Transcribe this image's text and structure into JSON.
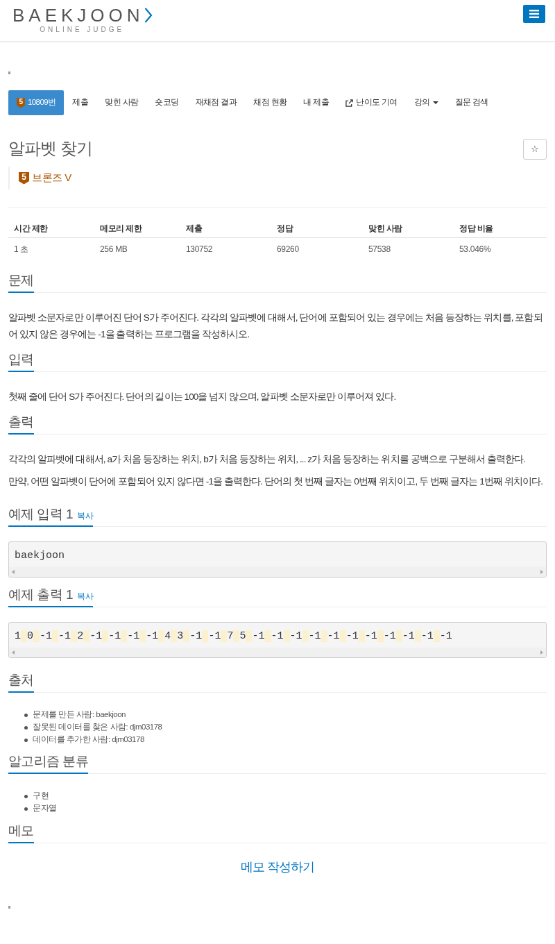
{
  "header": {
    "logo": {
      "wordmark": "BAEKJOON",
      "tagline": "ONLINE JUDGE"
    }
  },
  "tabs": [
    {
      "kind": "plain",
      "label": "10809번",
      "badge": "5",
      "selected": true
    },
    {
      "kind": "plain",
      "label": "제출",
      "selected": false
    },
    {
      "kind": "plain",
      "label": "맞힌 사람",
      "selected": false
    },
    {
      "kind": "plain",
      "label": "숏코딩",
      "selected": false
    },
    {
      "kind": "plain",
      "label": "재채점 결과",
      "selected": false
    },
    {
      "kind": "plain",
      "label": "채점 현황",
      "selected": false
    },
    {
      "kind": "plain",
      "label": "내 제출",
      "selected": false
    },
    {
      "kind": "external",
      "label": "난이도 기여",
      "selected": false
    },
    {
      "kind": "dropdown",
      "label": "강의",
      "selected": false
    },
    {
      "kind": "plain",
      "label": "질문 검색",
      "selected": false
    }
  ],
  "problem": {
    "title": "알파벳 찾기",
    "favorite_button": "☆",
    "tier": {
      "badge": "5",
      "name": "브론즈 V"
    }
  },
  "stats": {
    "columns": [
      "시간 제한",
      "메모리 제한",
      "제출",
      "정답",
      "맞힌 사람",
      "정답 비율"
    ],
    "rows": [
      [
        "1 초",
        "256 MB",
        "130752",
        "69260",
        "57538",
        "53.046%"
      ]
    ]
  },
  "sections": [
    {
      "kind": "text",
      "title": "문제",
      "paragraphs": [
        "알파벳 소문자로만 이루어진 단어 S가 주어진다. 각각의 알파벳에 대해서, 단어에 포함되어 있는 경우에는 처음 등장하는 위치를, 포함되어 있지 않은 경우에는 -1을 출력하는 프로그램을 작성하시오."
      ]
    },
    {
      "kind": "text",
      "title": "입력",
      "paragraphs": [
        "첫째 줄에 단어 S가 주어진다. 단어의 길이는 100을 넘지 않으며, 알파벳 소문자로만 이루어져 있다."
      ]
    },
    {
      "kind": "text",
      "title": "출력",
      "paragraphs": [
        "각각의 알파벳에 대해서, a가 처음 등장하는 위치, b가 처음 등장하는 위치, ... z가 처음 등장하는 위치를 공백으로 구분해서 출력한다.",
        "만약, 어떤 알파벳이 단어에 포함되어 있지 않다면 -1을 출력한다. 단어의 첫 번째 글자는 0번째 위치이고, 두 번째 글자는 1번째 위치이다."
      ]
    },
    {
      "kind": "sample",
      "title": "예제 입력 1",
      "copy": "복사",
      "content": "baekjoon"
    },
    {
      "kind": "sample",
      "title": "예제 출력 1",
      "copy": "복사",
      "content": "1 0 -1 -1 2 -1 -1 -1 -1 4 3 -1 -1 7 5 -1 -1 -1 -1 -1 -1 -1 -1 -1 -1 -1",
      "spaces_highlighted": true
    },
    {
      "kind": "list",
      "title": "출처",
      "items": [
        "문제를 만든 사람: baekjoon",
        "잘못된 데이터를 찾은 사람: djm03178",
        "데이터를 추가한 사람: djm03178"
      ]
    },
    {
      "kind": "list",
      "title": "알고리즘 분류",
      "items": [
        "구현",
        "문자열"
      ]
    },
    {
      "kind": "memo",
      "title": "메모",
      "link": "메모 작성하기"
    }
  ]
}
